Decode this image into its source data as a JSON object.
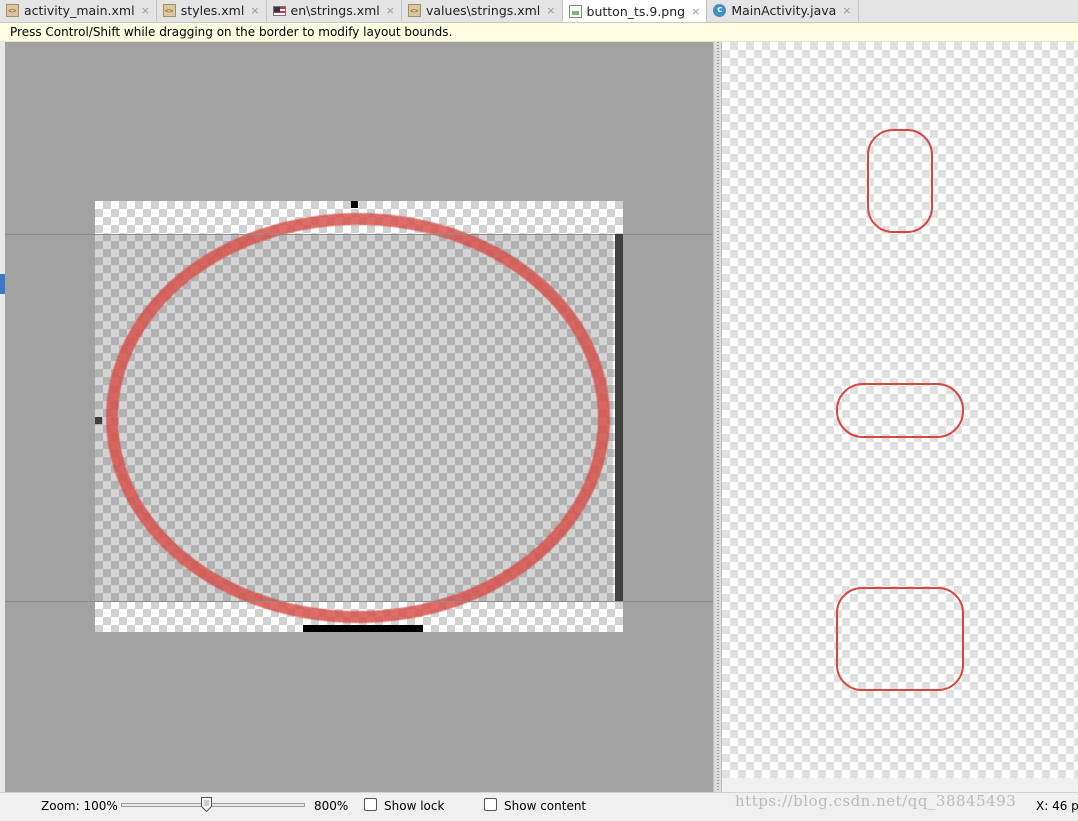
{
  "tabs": [
    {
      "label": "activity_main.xml",
      "icon": "xml-file-icon",
      "active": false
    },
    {
      "label": "styles.xml",
      "icon": "xml-file-icon",
      "active": false
    },
    {
      "label": "en\\strings.xml",
      "icon": "us-flag-icon",
      "active": false
    },
    {
      "label": "values\\strings.xml",
      "icon": "xml-file-icon",
      "active": false
    },
    {
      "label": "button_ts.9.png",
      "icon": "png-file-icon",
      "active": true
    },
    {
      "label": "MainActivity.java",
      "icon": "java-class-icon",
      "active": false
    }
  ],
  "tab_close_glyph": "×",
  "java_icon_letter": "c",
  "hint": "Press Control/Shift while dragging on the border to modify layout bounds.",
  "bottom": {
    "zoom_label": "Zoom: 100%",
    "zoom_max": "800%",
    "zoom_level_fraction": 0.5,
    "show_lock": {
      "label": "Show lock",
      "checked": false
    },
    "show_content": {
      "label": "Show content",
      "checked": false
    },
    "coords": "X: 46 p"
  },
  "watermark": "https://blog.csdn.net/qq_38845493",
  "colors": {
    "stroke": "#d9453f",
    "editor_bg": "#a2a2a2",
    "hint_bg": "#fdfde2"
  }
}
